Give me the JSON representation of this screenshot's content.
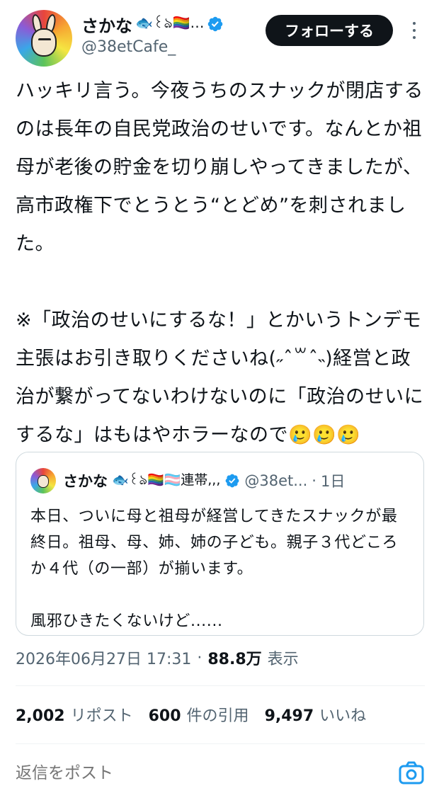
{
  "author": {
    "display_name": "さかな",
    "name_emojis": "🐟꒰ঌ🏳️‍🌈…",
    "handle": "@38etCafe_",
    "verified": true
  },
  "header": {
    "follow_label": "フォローする"
  },
  "tweet": {
    "text": "ハッキリ言う。今夜うちのスナックが閉店するのは長年の自民党政治のせいです。なんとか祖母が老後の貯金を切り崩しやってきましたが、高市政権下でとうとう“とどめ”を刺されました。\n\n※「政治のせいにするな！」とかいうトンデモ主張はお引き取りくださいね(˶ˆ꒳ˆ˵)経営と政治が繋がってないわけないのに「政治のせいにするな」はもはやホラーなので🥲🥲🥲"
  },
  "quote": {
    "display_name": "さかな",
    "name_emojis": "🐟꒰ঌ🏳️‍🌈🏳️‍⚧️連帯,,,",
    "handle": "@38et...",
    "separator": "·",
    "time": "1日",
    "text": "本日、ついに母と祖母が経営してきたスナックが最終日。祖母、母、姉、姉の子ども。親子３代どころか４代（の一部）が揃います。\n\n風邪ひきたくないけど......"
  },
  "meta": {
    "timestamp": "2026年06月27日 17:31",
    "separator": "·",
    "views": "88.8万",
    "views_label": "表示"
  },
  "stats": {
    "reposts": "2,002",
    "reposts_label": "リポスト",
    "quotes": "600",
    "quotes_label": "件の引用",
    "likes": "9,497",
    "likes_label": "いいね"
  },
  "reply": {
    "placeholder": "返信をポスト"
  },
  "colors": {
    "verified": "#1d9bf0",
    "secondary_text": "#536471",
    "follow_bg": "#0f1419"
  },
  "icons": [
    "verified-badge-icon",
    "more-options-icon",
    "camera-icon"
  ]
}
